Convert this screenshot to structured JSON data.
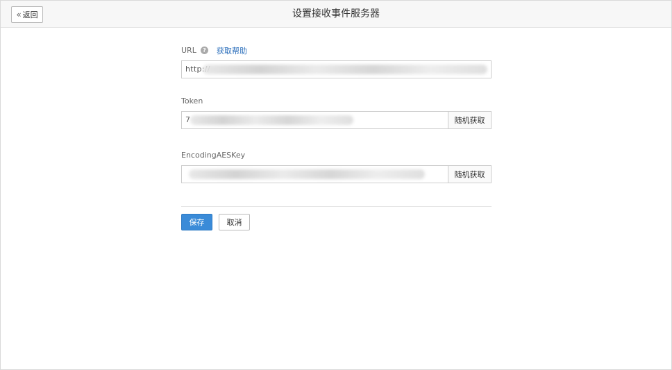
{
  "header": {
    "back_label": "返回",
    "back_icon": "double-chevron-left-icon",
    "title": "设置接收事件服务器"
  },
  "form": {
    "url": {
      "label": "URL",
      "help_icon": "question-icon",
      "help_link": "获取帮助",
      "value": "http://                                                    "
    },
    "token": {
      "label": "Token",
      "value": "7",
      "random_label": "随机获取"
    },
    "aes_key": {
      "label": "EncodingAESKey",
      "value": "",
      "random_label": "随机获取"
    }
  },
  "actions": {
    "save_label": "保存",
    "cancel_label": "取消"
  },
  "colors": {
    "primary": "#3a8bd8",
    "link": "#2a6ebb",
    "header_bg": "#f7f7f7"
  }
}
